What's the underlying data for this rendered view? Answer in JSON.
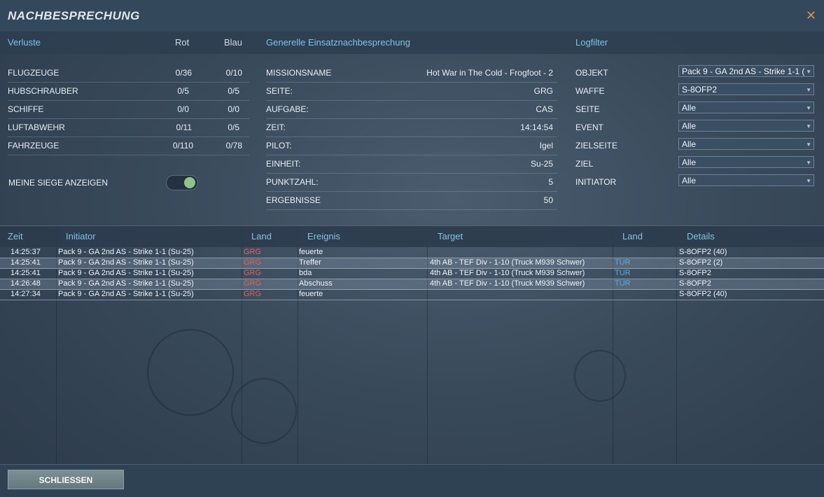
{
  "header": {
    "title": "NACHBESPRECHUNG",
    "close_icon": "close-icon"
  },
  "losses": {
    "heading": "Verluste",
    "col_red": "Rot",
    "col_blue": "Blau",
    "rows": [
      {
        "label": "FLUGZEUGE",
        "red": "0/36",
        "blue": "0/10"
      },
      {
        "label": "HUBSCHRAUBER",
        "red": "0/5",
        "blue": "0/5"
      },
      {
        "label": "SCHIFFE",
        "red": "0/0",
        "blue": "0/0"
      },
      {
        "label": "LUFTABWEHR",
        "red": "0/11",
        "blue": "0/5"
      },
      {
        "label": "FAHRZEUGE",
        "red": "0/110",
        "blue": "0/78"
      }
    ],
    "toggle_label": "MEINE SIEGE ANZEIGEN",
    "toggle_on": true
  },
  "debrief": {
    "heading": "Generelle Einsatznachbesprechung",
    "rows": [
      {
        "label": "MISSIONSNAME",
        "value": "Hot War in The Cold - Frogfoot - 2"
      },
      {
        "label": "SEITE:",
        "value": "GRG"
      },
      {
        "label": "AUFGABE:",
        "value": "CAS"
      },
      {
        "label": "ZEIT:",
        "value": "14:14:54"
      },
      {
        "label": "PILOT:",
        "value": "Igel"
      },
      {
        "label": "EINHEIT:",
        "value": "Su-25"
      },
      {
        "label": "PUNKTZAHL:",
        "value": "5"
      },
      {
        "label": "ERGEBNISSE",
        "value": "50"
      }
    ]
  },
  "logfilter": {
    "heading": "Logfilter",
    "filters": [
      {
        "label": "OBJEKT",
        "value": "Pack 9 - GA 2nd AS - Strike 1-1 ("
      },
      {
        "label": "WAFFE",
        "value": "S-8OFP2"
      },
      {
        "label": "SEITE",
        "value": "Alle"
      },
      {
        "label": "EVENT",
        "value": "Alle"
      },
      {
        "label": "ZIELSEITE",
        "value": "Alle"
      },
      {
        "label": "ZIEL",
        "value": "Alle"
      },
      {
        "label": "INITIATOR",
        "value": "Alle"
      }
    ]
  },
  "log": {
    "columns": [
      "Zeit",
      "Initiator",
      "Land",
      "Ereignis",
      "Target",
      "Land",
      "Details"
    ],
    "rows": [
      {
        "time": "14:25:37",
        "initiator": "Pack 9 - GA 2nd AS - Strike 1-1 (Su-25)",
        "land": "GRG",
        "event": "feuerte",
        "target": "",
        "target_land": "",
        "details": "S-8OFP2 (40)"
      },
      {
        "time": "14:25:41",
        "initiator": "Pack 9 - GA 2nd AS - Strike 1-1 (Su-25)",
        "land": "GRG",
        "event": "Treffer",
        "target": "4th AB - TEF Div - 1-10 (Truck M939 Schwer)",
        "target_land": "TUR",
        "details": "S-8OFP2 (2)"
      },
      {
        "time": "14:25:41",
        "initiator": "Pack 9 - GA 2nd AS - Strike 1-1 (Su-25)",
        "land": "GRG",
        "event": "bda",
        "target": "4th AB - TEF Div - 1-10 (Truck M939 Schwer)",
        "target_land": "TUR",
        "details": "S-8OFP2"
      },
      {
        "time": "14:26:48",
        "initiator": "Pack 9 - GA 2nd AS - Strike 1-1 (Su-25)",
        "land": "GRG",
        "event": "Abschuss",
        "target": "4th AB - TEF Div - 1-10 (Truck M939 Schwer)",
        "target_land": "TUR",
        "details": "S-8OFP2"
      },
      {
        "time": "14:27:34",
        "initiator": "Pack 9 - GA 2nd AS - Strike 1-1 (Su-25)",
        "land": "GRG",
        "event": "feuerte",
        "target": "",
        "target_land": "",
        "details": "S-8OFP2 (40)"
      }
    ]
  },
  "footer": {
    "close_label": "SCHLIESSEN"
  },
  "colors": {
    "accent": "#7ec2e6",
    "red_side": "#e0605a",
    "blue_side": "#5aa8e6",
    "toggle_on": "#8fc38a"
  }
}
